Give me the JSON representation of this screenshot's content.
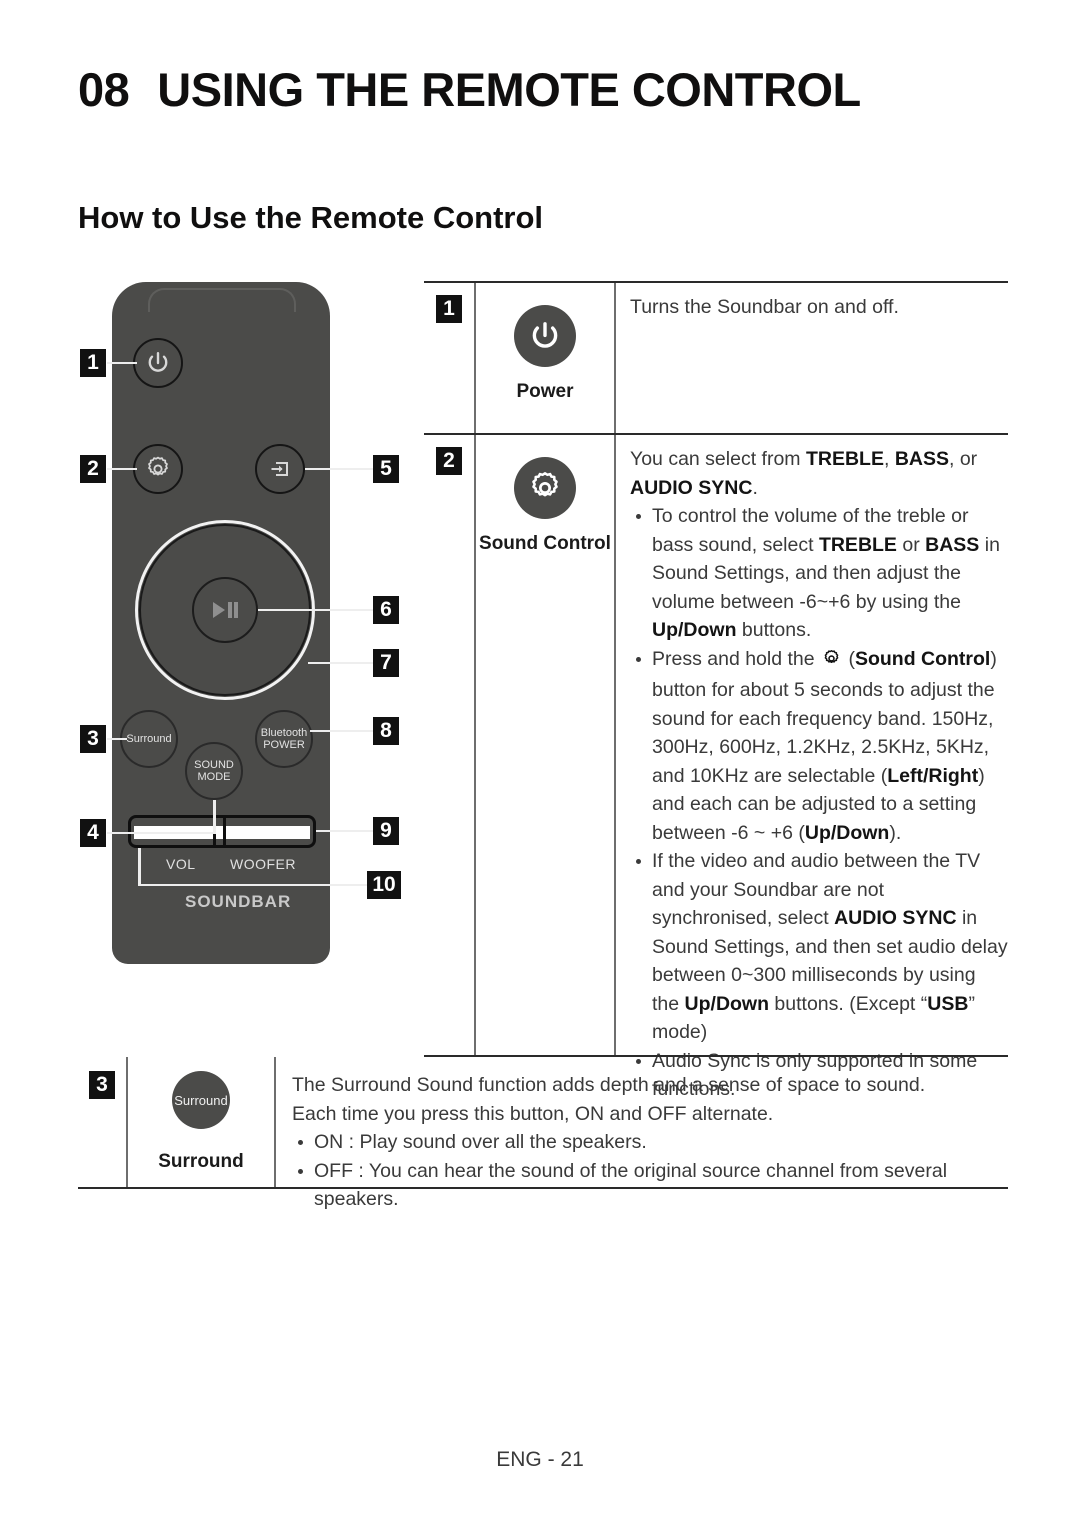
{
  "header": {
    "chapter_number": "08",
    "title": "USING THE REMOTE CONTROL",
    "section": "How to Use the Remote Control"
  },
  "remote": {
    "buttons": {
      "power": "power-icon",
      "sound_control": "gear-icon",
      "source": "source-input-icon",
      "play_pause": "play-pause-icon",
      "surround": "Surround",
      "sound_mode_line1": "SOUND",
      "sound_mode_line2": "MODE",
      "bluetooth_line1": "Bluetooth",
      "bluetooth_line2": "POWER"
    },
    "captions": {
      "vol": "VOL",
      "woofer": "WOOFER",
      "soundbar": "SOUNDBAR"
    },
    "callouts": [
      "1",
      "2",
      "3",
      "4",
      "5",
      "6",
      "7",
      "8",
      "9",
      "10"
    ]
  },
  "table": {
    "rows": [
      {
        "number": "1",
        "icon": "power-icon",
        "icon_caption": "Power",
        "description": "Turns the Soundbar on and off."
      },
      {
        "number": "2",
        "icon": "gear-icon",
        "icon_caption": "Sound Control",
        "intro_part1": "You can select from ",
        "intro_bold1": "TREBLE",
        "intro_part2": ", ",
        "intro_bold2": "BASS",
        "intro_part3": ", or ",
        "intro_bold3": "AUDIO SYNC",
        "intro_part4": ".",
        "bullets": [
          {
            "segments": [
              {
                "t": "To control the volume of the treble or bass sound, select ",
                "b": false
              },
              {
                "t": "TREBLE",
                "b": true
              },
              {
                "t": " or ",
                "b": false
              },
              {
                "t": "BASS",
                "b": true
              },
              {
                "t": " in Sound Settings, and then adjust the volume between -6~+6 by using the ",
                "b": false
              },
              {
                "t": "Up/Down",
                "b": true
              },
              {
                "t": " buttons.",
                "b": false
              }
            ]
          },
          {
            "segments": [
              {
                "t": "Press and hold the ",
                "b": false
              },
              {
                "t": "GEAR_ICON",
                "b": false
              },
              {
                "t": " (",
                "b": false
              },
              {
                "t": "Sound Control",
                "b": true
              },
              {
                "t": ") button for about 5 seconds to adjust the sound for each frequency band. 150Hz, 300Hz, 600Hz, 1.2KHz, 2.5KHz, 5KHz, and 10KHz are selectable (",
                "b": false
              },
              {
                "t": "Left/Right",
                "b": true
              },
              {
                "t": ") and each can be adjusted to a setting between -6 ~ +6 (",
                "b": false
              },
              {
                "t": "Up/Down",
                "b": true
              },
              {
                "t": ").",
                "b": false
              }
            ]
          },
          {
            "segments": [
              {
                "t": "If the video and audio between the TV and your Soundbar are not synchronised, select ",
                "b": false
              },
              {
                "t": "AUDIO SYNC",
                "b": true
              },
              {
                "t": " in Sound Settings, and then set audio delay between 0~300 milliseconds by using the ",
                "b": false
              },
              {
                "t": "Up/Down",
                "b": true
              },
              {
                "t": " buttons. (Except “",
                "b": false
              },
              {
                "t": "USB",
                "b": true
              },
              {
                "t": "” mode)",
                "b": false
              }
            ]
          },
          {
            "segments": [
              {
                "t": "Audio Sync is only supported in some functions.",
                "b": false
              }
            ]
          }
        ]
      },
      {
        "number": "3",
        "icon": "surround-button-icon",
        "icon_badge_text": "Surround",
        "icon_caption": "Surround",
        "line1": "The Surround Sound function adds depth and a sense of space to sound.",
        "line2": "Each time you press this button, ON and OFF alternate.",
        "bullets": [
          "ON : Play sound over all the speakers.",
          "OFF : You can hear the sound of the original source channel from several speakers."
        ]
      }
    ]
  },
  "footer": {
    "page_label": "ENG - 21"
  },
  "colors": {
    "remote_body": "#4b4b49",
    "text": "#3a3a3a",
    "rule": "#2a2a2a"
  }
}
